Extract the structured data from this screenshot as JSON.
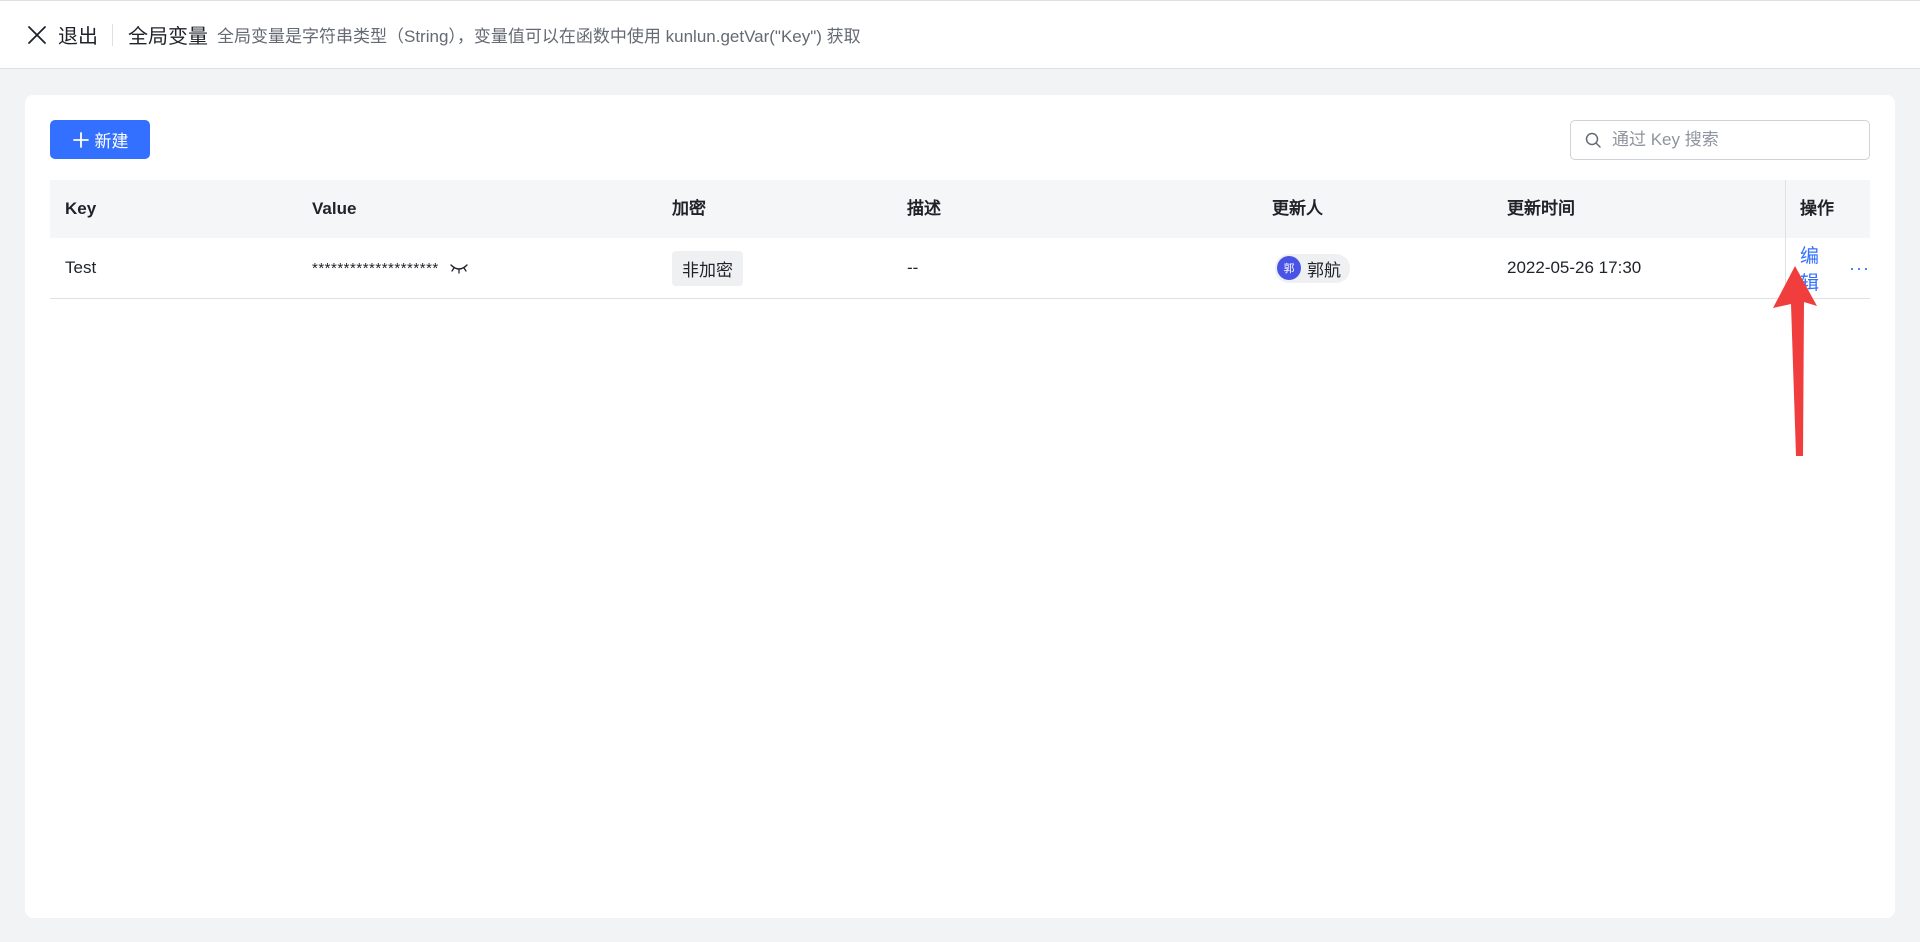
{
  "header": {
    "exit_label": "退出",
    "title": "全局变量",
    "description": "全局变量是字符串类型（String），变量值可以在函数中使用 kunlun.getVar(\"Key\") 获取"
  },
  "toolbar": {
    "new_button_label": "新建",
    "search_placeholder": "通过 Key 搜索"
  },
  "table": {
    "columns": [
      "Key",
      "Value",
      "加密",
      "描述",
      "更新人",
      "更新时间",
      "操作"
    ],
    "rows": [
      {
        "key": "Test",
        "value": "********************",
        "encryption": "非加密",
        "description": "--",
        "updater_avatar": "郭",
        "updater": "郭航",
        "updated_at": "2022-05-26 17:30",
        "action_edit": "编辑",
        "action_more": "···"
      }
    ]
  },
  "colors": {
    "primary": "#3370ff",
    "avatar": "#4954e6",
    "annotation_arrow": "#f03e3e",
    "background": "#f2f3f5"
  },
  "icons": [
    "close-icon",
    "plus-icon",
    "search-icon",
    "eye-closed-icon",
    "more-icon",
    "arrow-annotation"
  ]
}
